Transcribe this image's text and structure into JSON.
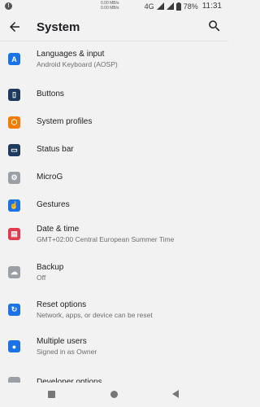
{
  "status_bar": {
    "net_up": "0.00 MB/s",
    "net_down": "0.00 MB/s",
    "network_type": "4G",
    "battery": "78%",
    "time": "11:31"
  },
  "header": {
    "title": "System",
    "back_icon": "arrow-left-icon",
    "search_icon": "search-icon"
  },
  "settings": [
    {
      "title": "Languages & input",
      "subtitle": "Android Keyboard (AOSP)",
      "icon": "language-icon",
      "color": "#1a73e8"
    },
    {
      "title": "Buttons",
      "subtitle": "",
      "icon": "buttons-icon",
      "color": "#1e3a5f"
    },
    {
      "title": "System profiles",
      "subtitle": "",
      "icon": "profiles-icon",
      "color": "#f57c00"
    },
    {
      "title": "Status bar",
      "subtitle": "",
      "icon": "status-bar-icon",
      "color": "#1e3a5f"
    },
    {
      "title": "MicroG",
      "subtitle": "",
      "icon": "gear-icon",
      "color": "#9aa0a6"
    },
    {
      "title": "Gestures",
      "subtitle": "",
      "icon": "gesture-icon",
      "color": "#1a73e8"
    },
    {
      "title": "Date & time",
      "subtitle": "GMT+02:00 Central European Summer Time",
      "icon": "calendar-icon",
      "color": "#e53950"
    },
    {
      "title": "Backup",
      "subtitle": "Off",
      "icon": "cloud-backup-icon",
      "color": "#9aa0a6"
    },
    {
      "title": "Reset options",
      "subtitle": "Network, apps, or device can be reset",
      "icon": "reset-icon",
      "color": "#1a73e8"
    },
    {
      "title": "Multiple users",
      "subtitle": "Signed in as Owner",
      "icon": "user-icon",
      "color": "#1a73e8"
    },
    {
      "title": "Developer options",
      "subtitle": "",
      "icon": "code-icon",
      "color": "#9aa0a6"
    }
  ],
  "nav": {
    "recents_icon": "square-icon",
    "home_icon": "circle-icon",
    "back_icon": "triangle-back-icon"
  }
}
